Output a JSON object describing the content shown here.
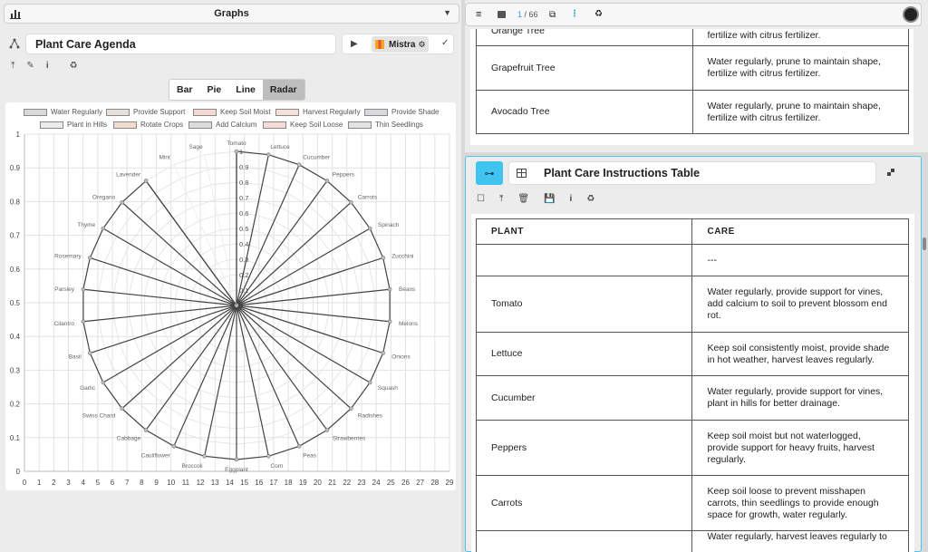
{
  "header": {
    "title": "Graphs"
  },
  "left_panel": {
    "title": "Plant Care Agenda",
    "model_label": "Mistra",
    "tabs": [
      "Bar",
      "Pie",
      "Line",
      "Radar"
    ],
    "active_tab": "Radar"
  },
  "right_toolbar": {
    "page_current": "1",
    "page_total": "/ 66"
  },
  "top_table": {
    "cut_label": "Orange Tree",
    "cut_care": "fertilize with citrus fertilizer.",
    "rows": [
      {
        "plant": "Grapefruit Tree",
        "care": "Water regularly, prune to maintain shape, fertilize with citrus fertilizer."
      },
      {
        "plant": "Avocado Tree",
        "care": "Water regularly, prune to maintain shape, fertilize with citrus fertilizer."
      }
    ]
  },
  "bottom_panel": {
    "title": "Plant Care Instructions Table",
    "headers": [
      "PLANT",
      "CARE"
    ],
    "rows": [
      {
        "plant": "",
        "care": "---"
      },
      {
        "plant": "Tomato",
        "care": "Water regularly, provide support for vines, add calcium to soil to prevent blossom end rot."
      },
      {
        "plant": "Lettuce",
        "care": "Keep soil consistently moist, provide shade in hot weather, harvest leaves regularly."
      },
      {
        "plant": "Cucumber",
        "care": "Water regularly, provide support for vines, plant in hills for better drainage."
      },
      {
        "plant": "Peppers",
        "care": "Keep soil moist but not waterlogged, provide support for heavy fruits, harvest regularly."
      },
      {
        "plant": "Carrots",
        "care": "Keep soil loose to prevent misshapen carrots, thin seedlings to provide enough space for growth, water regularly."
      }
    ],
    "cut_care": "Water regularly, harvest leaves regularly to"
  },
  "chart_data": {
    "type": "radar",
    "legend": [
      {
        "name": "Water Regularly",
        "color": "#d9d9d9"
      },
      {
        "name": "Provide Support",
        "color": "#e6e0dc"
      },
      {
        "name": "Keep Soil Moist",
        "color": "#f3d9d3"
      },
      {
        "name": "Harvest Regularly",
        "color": "#f6e0da"
      },
      {
        "name": "Provide Shade",
        "color": "#d7d9dc"
      },
      {
        "name": "Plant in Hills",
        "color": "#ececec"
      },
      {
        "name": "Rotate Crops",
        "color": "#f4dbd1"
      },
      {
        "name": "Add Calcium",
        "color": "#dcdcdc"
      },
      {
        "name": "Keep Soil Loose",
        "color": "#f5ddd5"
      },
      {
        "name": "Thin Seedlings",
        "color": "#e3e3e3"
      }
    ],
    "categories": [
      "Tomato",
      "Lettuce",
      "Cucumber",
      "Peppers",
      "Carrots",
      "Spinach",
      "Zucchini",
      "Beans",
      "Melons",
      "Onions",
      "Squash",
      "Radishes",
      "Strawberries",
      "Peas",
      "Corn",
      "Eggplant",
      "Broccoli",
      "Cauliflower",
      "Cabbage",
      "Swiss Chard",
      "Garlic",
      "Basil",
      "Cilantro",
      "Parsley",
      "Rosemary",
      "Thyme",
      "Oregano",
      "Lavender",
      "Mint",
      "Sage"
    ],
    "values": [
      1,
      1,
      1,
      1,
      1,
      1,
      1,
      1,
      1,
      1,
      1,
      1,
      1,
      1,
      1,
      1,
      1,
      1,
      1,
      1,
      1,
      1,
      1,
      1,
      1,
      1,
      1,
      1,
      0,
      0
    ],
    "radial_ticks": [
      0,
      0.1,
      0.2,
      0.3,
      0.4,
      0.5,
      0.6,
      0.7,
      0.8,
      0.9,
      1
    ],
    "x_ticks": [
      0,
      1,
      2,
      3,
      4,
      5,
      6,
      7,
      8,
      9,
      10,
      11,
      12,
      13,
      14,
      15,
      16,
      17,
      18,
      19,
      20,
      21,
      22,
      23,
      24,
      25,
      26,
      27,
      28,
      29
    ],
    "y_ticks": [
      0,
      0.1,
      0.2,
      0.3,
      0.4,
      0.5,
      0.6,
      0.7,
      0.8,
      0.9,
      1
    ],
    "grid": true
  }
}
